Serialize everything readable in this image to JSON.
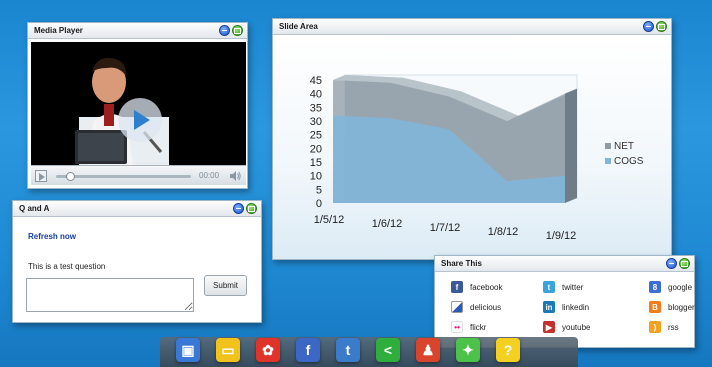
{
  "media_player": {
    "title": "Media Player",
    "time": "00:00"
  },
  "qa": {
    "title": "Q and A",
    "refresh": "Refresh now",
    "question": "This is a test question",
    "answer_value": "",
    "submit_label": "Submit"
  },
  "slide": {
    "title": "Slide Area"
  },
  "chart_data": {
    "type": "area",
    "x": [
      "1/5/12",
      "1/6/12",
      "1/7/12",
      "1/8/12",
      "1/9/12"
    ],
    "series": [
      {
        "name": "NET",
        "values": [
          45,
          44,
          39,
          30,
          40
        ]
      },
      {
        "name": "COGS",
        "values": [
          32,
          31,
          27,
          8,
          10
        ]
      }
    ],
    "ylim": [
      0,
      45
    ],
    "yticks": [
      "0",
      "5",
      "10",
      "15",
      "20",
      "25",
      "30",
      "35",
      "40",
      "45"
    ],
    "legend_position": "right",
    "colors": {
      "NET": "#8e9aa4",
      "COGS": "#7fb6dc"
    }
  },
  "share": {
    "title": "Share This",
    "items": [
      {
        "label": "facebook",
        "icon": "facebook-icon",
        "glyph": "f",
        "color": "#3b5998"
      },
      {
        "label": "twitter",
        "icon": "twitter-icon",
        "glyph": "t",
        "color": "#3aa3dc"
      },
      {
        "label": "google",
        "icon": "google-icon",
        "glyph": "8",
        "color": "#3a6fd1"
      },
      {
        "label": "delicious",
        "icon": "delicious-icon",
        "glyph": "",
        "color": "#2b59b8"
      },
      {
        "label": "linkedin",
        "icon": "linkedin-icon",
        "glyph": "in",
        "color": "#1c78b6"
      },
      {
        "label": "blogger",
        "icon": "blogger-icon",
        "glyph": "B",
        "color": "#f07c1a"
      },
      {
        "label": "flickr",
        "icon": "flickr-icon",
        "glyph": "••",
        "color": "#ffffff"
      },
      {
        "label": "youtube",
        "icon": "youtube-icon",
        "glyph": "▶",
        "color": "#c4302b"
      },
      {
        "label": "rss",
        "icon": "rss-icon",
        "glyph": ")",
        "color": "#f4a224"
      }
    ]
  },
  "dock": {
    "items": [
      {
        "name": "video-icon",
        "color": "#3a78d6",
        "glyph": "▣"
      },
      {
        "name": "slides-icon",
        "color": "#f2c21c",
        "glyph": "▭"
      },
      {
        "name": "chat-icon",
        "color": "#e0342a",
        "glyph": "✿"
      },
      {
        "name": "facebook-icon",
        "color": "#3b68c4",
        "glyph": "f"
      },
      {
        "name": "twitter-icon",
        "color": "#3a7cc9",
        "glyph": "t"
      },
      {
        "name": "share-icon",
        "color": "#2fae3d",
        "glyph": "<"
      },
      {
        "name": "people-icon",
        "color": "#d8452c",
        "glyph": "♟"
      },
      {
        "name": "idea-icon",
        "color": "#4cc24a",
        "glyph": "✦"
      },
      {
        "name": "help-icon",
        "color": "#f4d021",
        "glyph": "?"
      }
    ]
  }
}
